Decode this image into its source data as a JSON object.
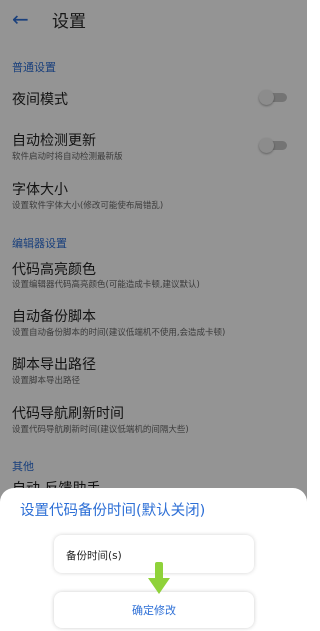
{
  "header": {
    "title": "设置",
    "back_icon": "arrow-left-icon"
  },
  "sections": {
    "general": "普通设置",
    "editor": "编辑器设置",
    "other": "其他"
  },
  "items": {
    "night_mode": {
      "title": "夜间模式",
      "toggle_on": false
    },
    "auto_update": {
      "title": "自动检测更新",
      "subtitle": "软件启动时将自动检测最新版",
      "toggle_on": false
    },
    "font_size": {
      "title": "字体大小",
      "subtitle": "设置软件字体大小(修改可能使布局错乱)"
    },
    "code_highlight": {
      "title": "代码高亮颜色",
      "subtitle": "设置编辑器代码高亮颜色(可能造成卡顿,建议默认)"
    },
    "auto_backup": {
      "title": "自动备份脚本",
      "subtitle": "设置自动备份脚本的时间(建议低端机不使用,会造成卡顿)"
    },
    "export_path": {
      "title": "脚本导出路径",
      "subtitle": "设置脚本导出路径"
    },
    "nav_refresh": {
      "title": "代码导航刷新时间",
      "subtitle": "设置代码导航刷新时间(建议低端机的间隔大些)"
    },
    "other_partial": {
      "title": "自动 反馈助手"
    }
  },
  "dialog": {
    "title": "设置代码备份时间(默认关闭)",
    "input_label": "备份时间(s)",
    "confirm_label": "确定修改",
    "hint_icon": "green-down-arrow-icon"
  },
  "colors": {
    "accent": "#2d6fd6",
    "hint_arrow": "#8fd23a"
  }
}
